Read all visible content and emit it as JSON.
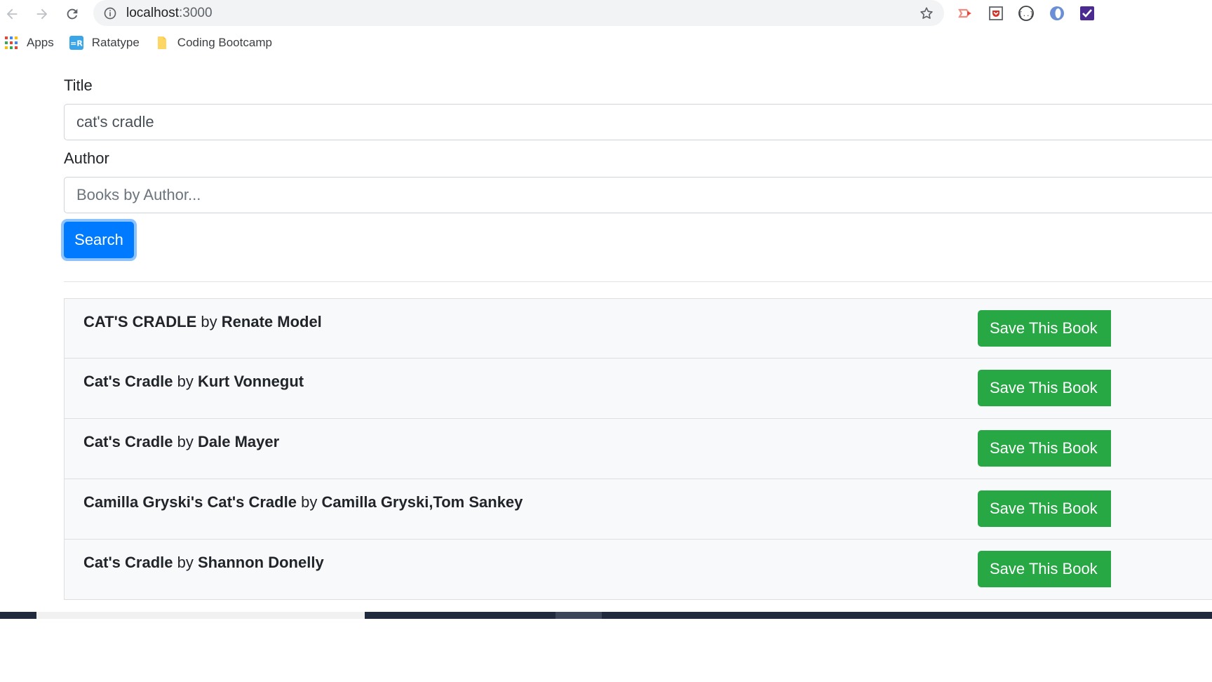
{
  "browser": {
    "url_host": "localhost",
    "url_port": ":3000",
    "bookmarks": [
      {
        "label": "Apps",
        "icon": "apps-grid-icon"
      },
      {
        "label": "Ratatype",
        "icon": "ratatype-icon"
      },
      {
        "label": "Coding Bootcamp",
        "icon": "folder-icon"
      }
    ],
    "extensions": [
      "cast-extension-icon",
      "pocket-icon",
      "json-viewer-icon",
      "opera-icon",
      "checkbox-extension-icon"
    ]
  },
  "form": {
    "title_label": "Title",
    "title_value": "cat's cradle",
    "author_label": "Author",
    "author_placeholder": "Books by Author...",
    "search_label": "Search"
  },
  "results": [
    {
      "title": "CAT'S CRADLE",
      "by": "by",
      "author": "Renate Model",
      "button": "Save This Book"
    },
    {
      "title": "Cat's Cradle",
      "by": "by",
      "author": "Kurt Vonnegut",
      "button": "Save This Book"
    },
    {
      "title": "Cat's Cradle",
      "by": "by",
      "author": "Dale Mayer",
      "button": "Save This Book"
    },
    {
      "title": "Camilla Gryski's Cat's Cradle",
      "by": "by",
      "author": "Camilla Gryski,Tom Sankey",
      "button": "Save This Book"
    },
    {
      "title": "Cat's Cradle",
      "by": "by",
      "author": "Shannon Donelly",
      "button": "Save This Book"
    }
  ],
  "colors": {
    "primary": "#007bff",
    "success": "#28a745",
    "row_bg": "#f8f9fa"
  }
}
